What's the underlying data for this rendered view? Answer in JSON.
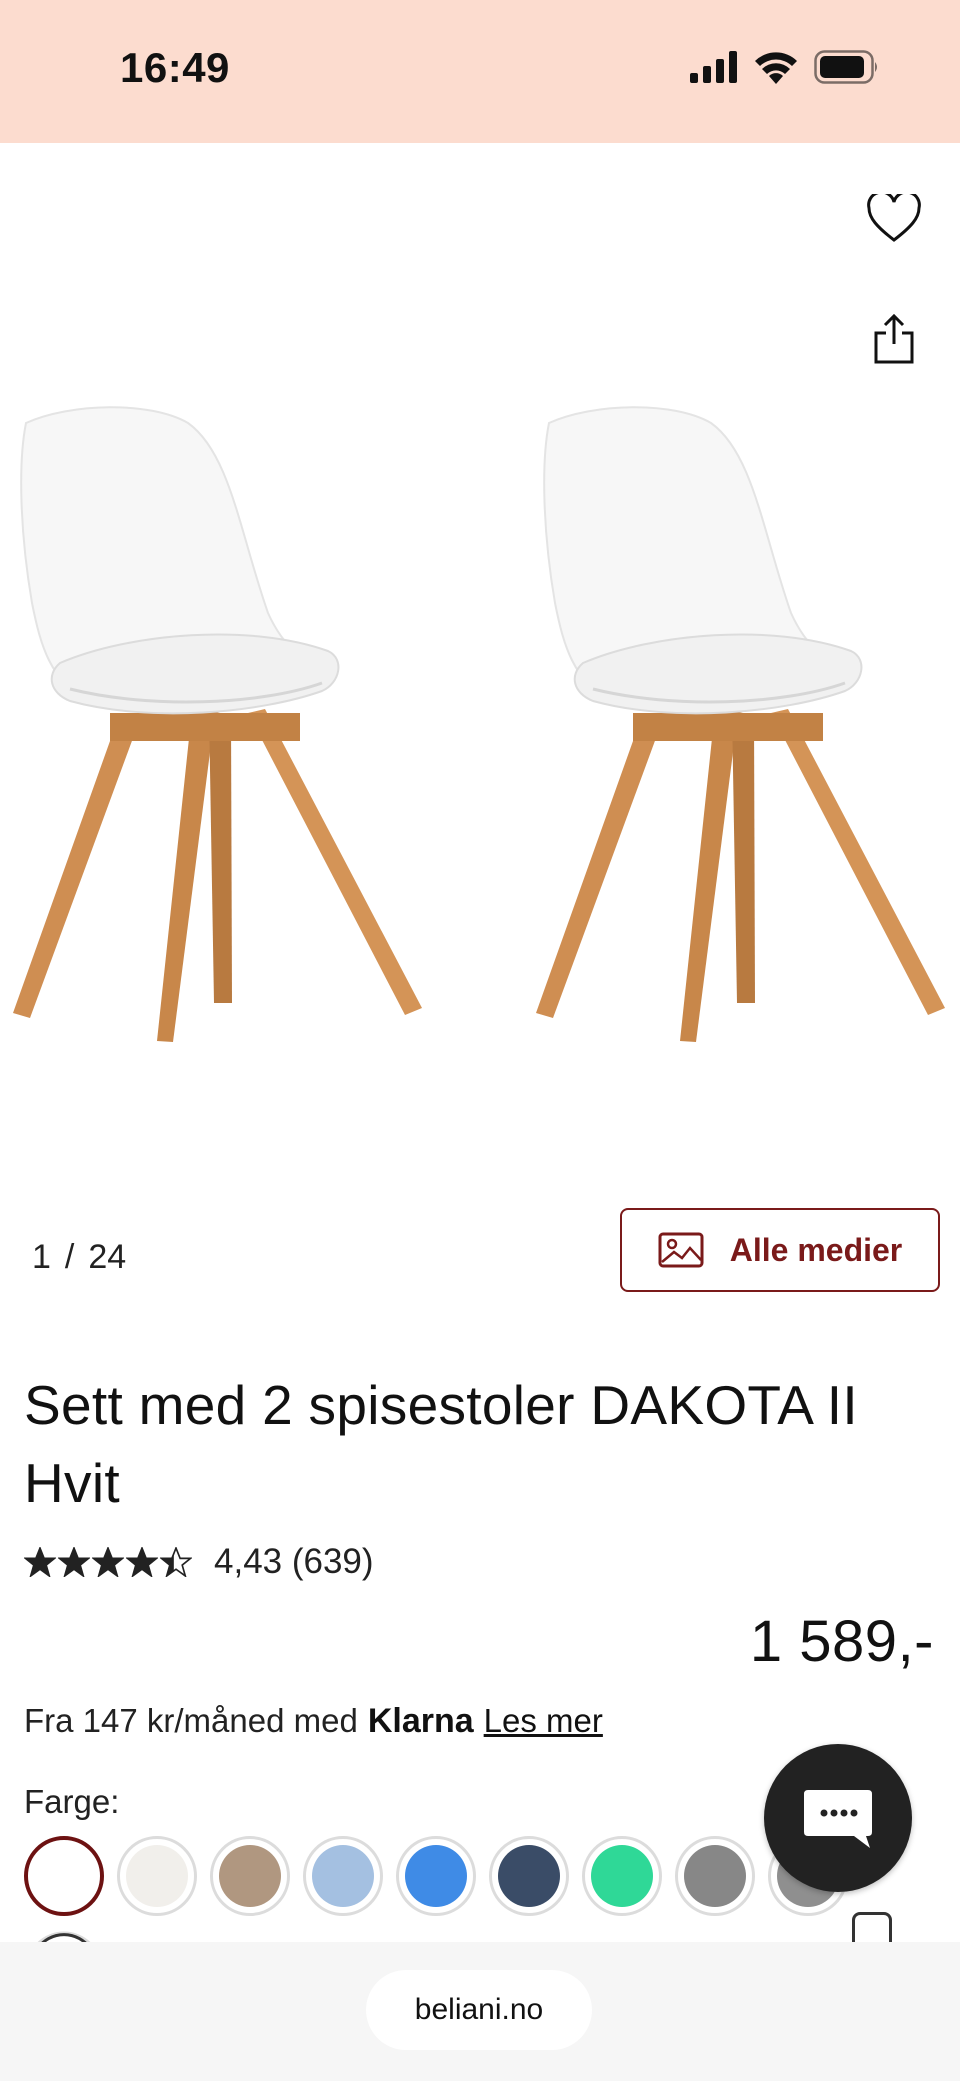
{
  "status_bar": {
    "time": "16:49"
  },
  "gallery": {
    "current": "1",
    "separator": "/",
    "total": "24",
    "media_button_label": "Alle medier"
  },
  "product": {
    "title": "Sett med 2 spisestoler DAKOTA II Hvit",
    "rating_value": 4.43,
    "rating_text": "4,43 (639)",
    "price": "1 589,-"
  },
  "financing": {
    "prefix": "Fra 147 kr/måned med",
    "brand": "Klarna",
    "link": "Les mer"
  },
  "color": {
    "label": "Farge:",
    "swatches": [
      "#ffffff",
      "#f1efeb",
      "#b09780",
      "#a4c0e1",
      "#3f8be6",
      "#3a4c67",
      "#2fd897",
      "#878787",
      "#8f8f8f"
    ],
    "selected_index": 0
  },
  "browser": {
    "url": "beliani.no"
  },
  "colors": {
    "status_bar_bg": "#fcdccf",
    "accent": "#7a1a1a"
  }
}
